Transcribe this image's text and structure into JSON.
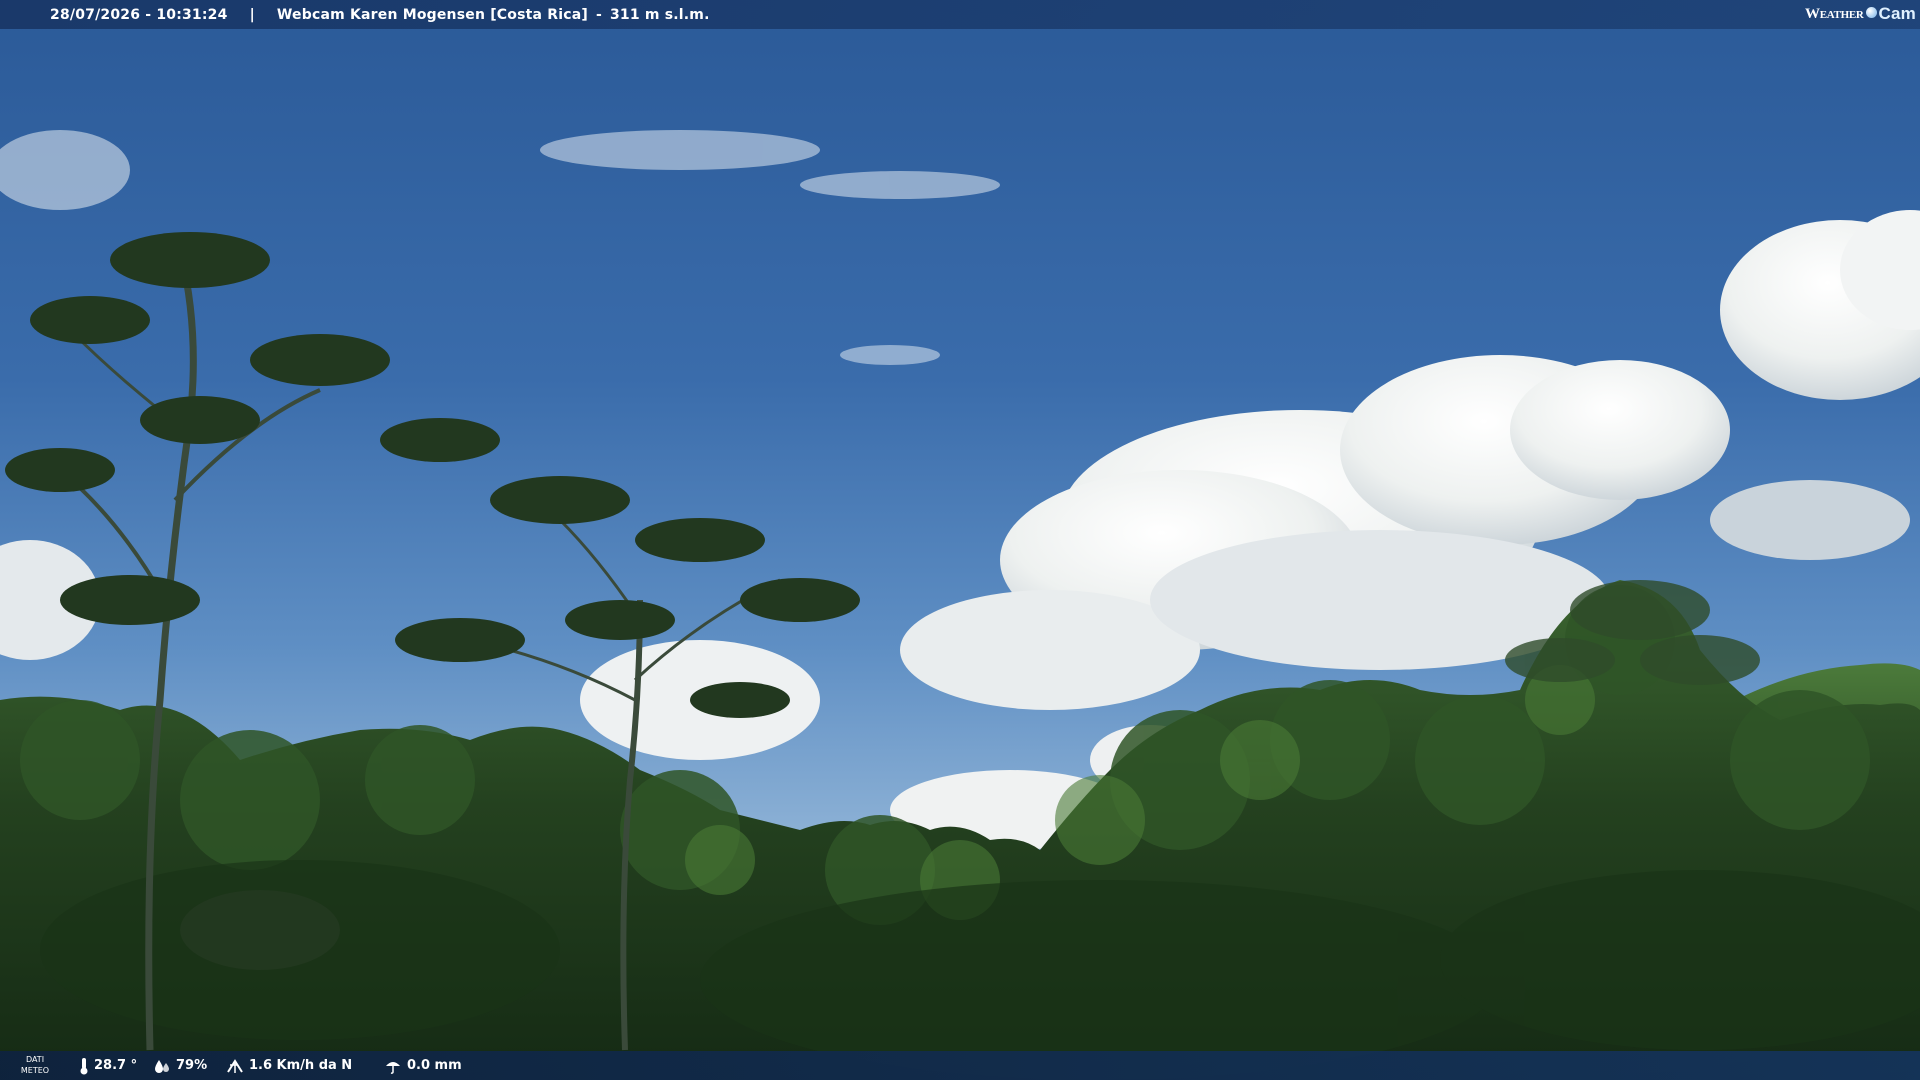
{
  "overlay": {
    "datetime": "28/07/2026 - 10:31:24",
    "separator": "|",
    "webcam_name": "Webcam Karen Mogensen [Costa Rica]",
    "altitude": "311 m s.l.m.",
    "logo": {
      "word": "Weather",
      "cam": "Cam"
    }
  },
  "weather": {
    "label_line1": "DATI",
    "label_line2": "METEO",
    "temperature": "28.7 °",
    "humidity": "79%",
    "wind": "1.6 Km/h da N",
    "rain": "0.0 mm",
    "icons": [
      "thermometer-icon",
      "humidity-drop-icon",
      "wind-icon",
      "rain-gauge-icon"
    ]
  },
  "colors": {
    "sky_top": "#2c5e9c",
    "sky_horizon": "#8fb3d6",
    "cloud": "#f3f5f4",
    "forest_dark": "#1c3519",
    "forest_light": "#3f6a2c",
    "bar": "#1c3c6e"
  }
}
